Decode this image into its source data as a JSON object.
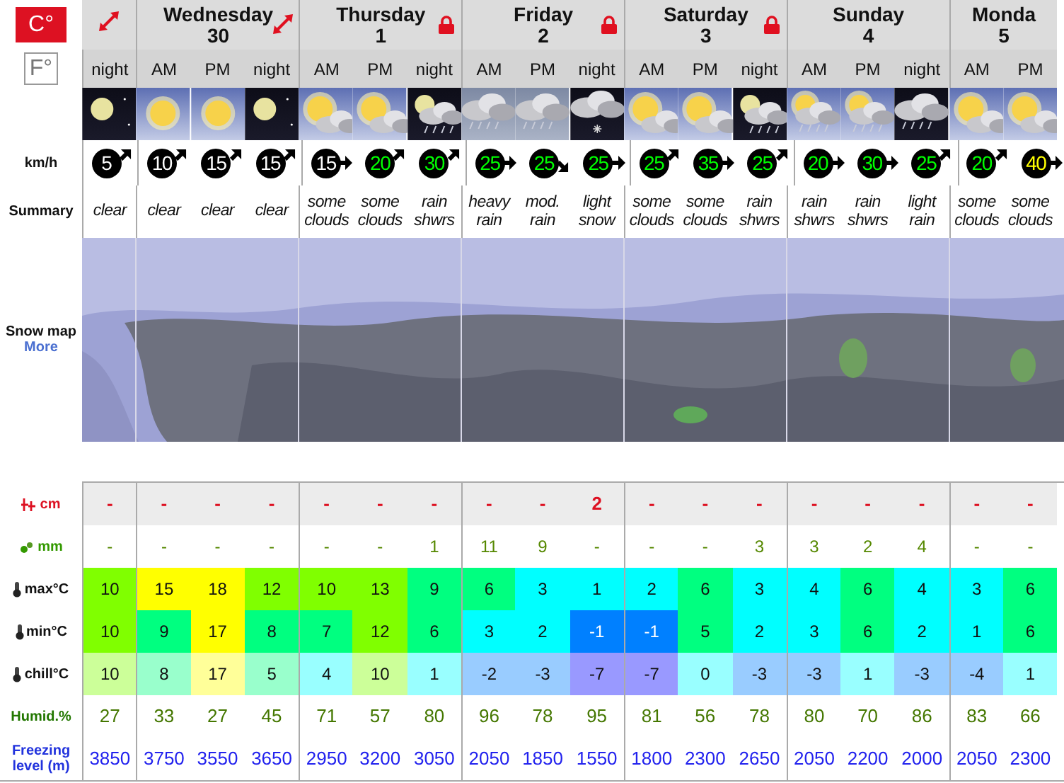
{
  "units": [
    {
      "label": "C°",
      "selected": true
    },
    {
      "label": "F°",
      "selected": false
    }
  ],
  "row_labels": {
    "wind": "km/h",
    "summary": "Summary",
    "map": "Snow map",
    "map_link": "More",
    "snow": "cm",
    "rain": "mm",
    "max": "max°C",
    "min": "min°C",
    "chill": "chill°C",
    "humidity": "Humid.%",
    "freezing": "Freezing level (m)"
  },
  "days": [
    {
      "expandable": true,
      "locked": false,
      "periods": [
        {
          "label": "night",
          "kind": "moon",
          "wind": {
            "value": "5",
            "color": "#ffffff",
            "kind": "northeast"
          },
          "summary": "clear",
          "snow": "-",
          "rain": "-",
          "max": {
            "value": "10",
            "color": "#80ff00"
          },
          "min": {
            "value": "10",
            "color": "#80ff00"
          },
          "chill": {
            "value": "10",
            "color": "#ccff99"
          },
          "humidity": "27",
          "freezing": "3850"
        }
      ]
    },
    {
      "name": "Wednesday",
      "date": "30",
      "expandable": true,
      "locked": false,
      "periods": [
        {
          "label": "AM",
          "kind": "sun",
          "wind": {
            "value": "10",
            "color": "#ffffff",
            "kind": "northeast"
          },
          "summary": "clear",
          "snow": "-",
          "rain": "-",
          "max": {
            "value": "15",
            "color": "#ffff00"
          },
          "min": {
            "value": "9",
            "color": "#00ff80"
          },
          "chill": {
            "value": "8",
            "color": "#99ffcc"
          },
          "humidity": "33",
          "freezing": "3750"
        },
        {
          "label": "PM",
          "kind": "sun",
          "wind": {
            "value": "15",
            "color": "#ffffff",
            "kind": "northeast"
          },
          "summary": "clear",
          "snow": "-",
          "rain": "-",
          "max": {
            "value": "18",
            "color": "#ffff00"
          },
          "min": {
            "value": "17",
            "color": "#ffff00"
          },
          "chill": {
            "value": "17",
            "color": "#ffff99"
          },
          "humidity": "27",
          "freezing": "3550"
        },
        {
          "label": "night",
          "kind": "moon",
          "wind": {
            "value": "15",
            "color": "#ffffff",
            "kind": "northeast"
          },
          "summary": "clear",
          "snow": "-",
          "rain": "-",
          "max": {
            "value": "12",
            "color": "#80ff00"
          },
          "min": {
            "value": "8",
            "color": "#00ff80"
          },
          "chill": {
            "value": "5",
            "color": "#99ffcc"
          },
          "humidity": "45",
          "freezing": "3650"
        }
      ]
    },
    {
      "name": "Thursday",
      "date": "1",
      "expandable": false,
      "locked": true,
      "periods": [
        {
          "label": "AM",
          "kind": "suncloud",
          "wind": {
            "value": "15",
            "color": "#ffffff",
            "kind": "east"
          },
          "summary": "some clouds",
          "snow": "-",
          "rain": "-",
          "max": {
            "value": "10",
            "color": "#80ff00"
          },
          "min": {
            "value": "7",
            "color": "#00ff80"
          },
          "chill": {
            "value": "4",
            "color": "#99ffff"
          },
          "humidity": "71",
          "freezing": "2950"
        },
        {
          "label": "PM",
          "kind": "suncloud",
          "wind": {
            "value": "20",
            "color": "#00ff00",
            "kind": "northeast"
          },
          "summary": "some clouds",
          "snow": "-",
          "rain": "-",
          "max": {
            "value": "13",
            "color": "#80ff00"
          },
          "min": {
            "value": "12",
            "color": "#80ff00"
          },
          "chill": {
            "value": "10",
            "color": "#ccff99"
          },
          "humidity": "57",
          "freezing": "3200"
        },
        {
          "label": "night",
          "kind": "nightshowers",
          "wind": {
            "value": "30",
            "color": "#00ff00",
            "kind": "northeast"
          },
          "summary": "rain shwrs",
          "snow": "-",
          "rain": "1",
          "max": {
            "value": "9",
            "color": "#00ff80"
          },
          "min": {
            "value": "6",
            "color": "#00ff80"
          },
          "chill": {
            "value": "1",
            "color": "#99ffff"
          },
          "humidity": "80",
          "freezing": "3050"
        }
      ]
    },
    {
      "name": "Friday",
      "date": "2",
      "expandable": false,
      "locked": true,
      "periods": [
        {
          "label": "AM",
          "kind": "rain",
          "wind": {
            "value": "25",
            "color": "#00ff00",
            "kind": "east"
          },
          "summary": "heavy rain",
          "snow": "-",
          "rain": "11",
          "max": {
            "value": "6",
            "color": "#00ff80"
          },
          "min": {
            "value": "3",
            "color": "#00ffff"
          },
          "chill": {
            "value": "-2",
            "color": "#99ccff"
          },
          "humidity": "96",
          "freezing": "2050"
        },
        {
          "label": "PM",
          "kind": "rain",
          "wind": {
            "value": "25",
            "color": "#00ff00",
            "kind": "southeast"
          },
          "summary": "mod. rain",
          "snow": "-",
          "rain": "9",
          "max": {
            "value": "3",
            "color": "#00ffff"
          },
          "min": {
            "value": "2",
            "color": "#00ffff"
          },
          "chill": {
            "value": "-3",
            "color": "#99ccff"
          },
          "humidity": "78",
          "freezing": "1850"
        },
        {
          "label": "night",
          "kind": "nightsnow",
          "wind": {
            "value": "25",
            "color": "#00ff00",
            "kind": "east"
          },
          "summary": "light snow",
          "snow": "2",
          "rain": "-",
          "max": {
            "value": "1",
            "color": "#00ffff"
          },
          "min": {
            "value": "-1",
            "color": "#0080ff"
          },
          "chill": {
            "value": "-7",
            "color": "#9999ff"
          },
          "humidity": "95",
          "freezing": "1550"
        }
      ]
    },
    {
      "name": "Saturday",
      "date": "3",
      "expandable": false,
      "locked": true,
      "periods": [
        {
          "label": "AM",
          "kind": "suncloud",
          "wind": {
            "value": "25",
            "color": "#00ff00",
            "kind": "northeast"
          },
          "summary": "some clouds",
          "snow": "-",
          "rain": "-",
          "max": {
            "value": "2",
            "color": "#00ffff"
          },
          "min": {
            "value": "-1",
            "color": "#0080ff"
          },
          "chill": {
            "value": "-7",
            "color": "#9999ff"
          },
          "humidity": "81",
          "freezing": "1800"
        },
        {
          "label": "PM",
          "kind": "suncloud",
          "wind": {
            "value": "35",
            "color": "#00ff00",
            "kind": "east"
          },
          "summary": "some clouds",
          "snow": "-",
          "rain": "-",
          "max": {
            "value": "6",
            "color": "#00ff80"
          },
          "min": {
            "value": "5",
            "color": "#00ff80"
          },
          "chill": {
            "value": "0",
            "color": "#99ffff"
          },
          "humidity": "56",
          "freezing": "2300"
        },
        {
          "label": "night",
          "kind": "nightshowers",
          "wind": {
            "value": "25",
            "color": "#00ff00",
            "kind": "northeast"
          },
          "summary": "rain shwrs",
          "snow": "-",
          "rain": "3",
          "max": {
            "value": "3",
            "color": "#00ffff"
          },
          "min": {
            "value": "2",
            "color": "#00ffff"
          },
          "chill": {
            "value": "-3",
            "color": "#99ccff"
          },
          "humidity": "78",
          "freezing": "2650"
        }
      ]
    },
    {
      "name": "Sunday",
      "date": "4",
      "expandable": false,
      "locked": false,
      "periods": [
        {
          "label": "AM",
          "kind": "sunshowers",
          "wind": {
            "value": "20",
            "color": "#00ff00",
            "kind": "east"
          },
          "summary": "rain shwrs",
          "snow": "-",
          "rain": "3",
          "max": {
            "value": "4",
            "color": "#00ffff"
          },
          "min": {
            "value": "3",
            "color": "#00ffff"
          },
          "chill": {
            "value": "-3",
            "color": "#99ccff"
          },
          "humidity": "80",
          "freezing": "2050"
        },
        {
          "label": "PM",
          "kind": "sunshowers",
          "wind": {
            "value": "30",
            "color": "#00ff00",
            "kind": "east"
          },
          "summary": "rain shwrs",
          "snow": "-",
          "rain": "2",
          "max": {
            "value": "6",
            "color": "#00ff80"
          },
          "min": {
            "value": "6",
            "color": "#00ff80"
          },
          "chill": {
            "value": "1",
            "color": "#99ffff"
          },
          "humidity": "70",
          "freezing": "2200"
        },
        {
          "label": "night",
          "kind": "nightrain",
          "wind": {
            "value": "25",
            "color": "#00ff00",
            "kind": "northeast"
          },
          "summary": "light rain",
          "snow": "-",
          "rain": "4",
          "max": {
            "value": "4",
            "color": "#00ffff"
          },
          "min": {
            "value": "2",
            "color": "#00ffff"
          },
          "chill": {
            "value": "-3",
            "color": "#99ccff"
          },
          "humidity": "86",
          "freezing": "2000"
        }
      ]
    },
    {
      "name": "Monda",
      "date": "5",
      "expandable": false,
      "locked": false,
      "periods": [
        {
          "label": "AM",
          "kind": "suncloud",
          "wind": {
            "value": "20",
            "color": "#00ff00",
            "kind": "northeast"
          },
          "summary": "some clouds",
          "snow": "-",
          "rain": "-",
          "max": {
            "value": "3",
            "color": "#00ffff"
          },
          "min": {
            "value": "1",
            "color": "#00ffff"
          },
          "chill": {
            "value": "-4",
            "color": "#99ccff"
          },
          "humidity": "83",
          "freezing": "2050"
        },
        {
          "label": "PM",
          "kind": "suncloud",
          "wind": {
            "value": "40",
            "color": "#ffff00",
            "kind": "east"
          },
          "summary": "some clouds",
          "snow": "-",
          "rain": "-",
          "max": {
            "value": "6",
            "color": "#00ff80"
          },
          "min": {
            "value": "6",
            "color": "#00ff80"
          },
          "chill": {
            "value": "1",
            "color": "#99ffff"
          },
          "humidity": "66",
          "freezing": "2300"
        }
      ]
    }
  ]
}
